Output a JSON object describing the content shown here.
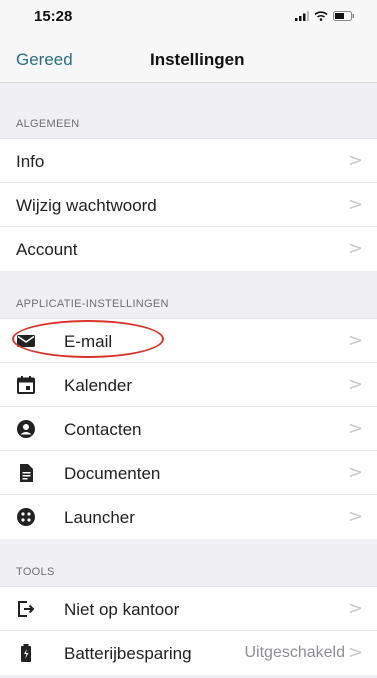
{
  "status_bar": {
    "time": "15:28"
  },
  "nav": {
    "left_button": "Gereed",
    "title": "Instellingen"
  },
  "sections": {
    "general": "ALGEMEEN",
    "app_settings": "APPLICATIE-INSTELLINGEN",
    "tools": "TOOLS"
  },
  "general_items": [
    "Info",
    "Wijzig wachtwoord",
    "Account"
  ],
  "app_items": [
    {
      "label": "E-mail",
      "icon": "mail-icon"
    },
    {
      "label": "Kalender",
      "icon": "calendar-icon"
    },
    {
      "label": "Contacten",
      "icon": "contact-icon"
    },
    {
      "label": "Documenten",
      "icon": "document-icon"
    },
    {
      "label": "Launcher",
      "icon": "launcher-icon"
    }
  ],
  "tools_items": [
    {
      "label": "Niet op kantoor",
      "icon": "out-of-office-icon"
    },
    {
      "label": "Batterijbesparing",
      "icon": "battery-icon",
      "value": "Uitgeschakeld"
    }
  ],
  "colors": {
    "accent": "#2b6e83",
    "highlight": "#d9342b"
  }
}
